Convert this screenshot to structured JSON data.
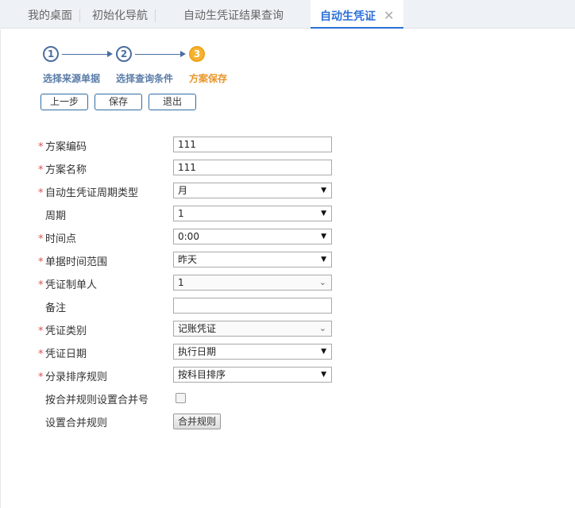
{
  "tabs": [
    {
      "label": "我的桌面"
    },
    {
      "label": "初始化导航"
    },
    {
      "label": "自动生凭证结果查询"
    },
    {
      "label": "自动生凭证",
      "close": "✕"
    }
  ],
  "steps": [
    {
      "num": "1",
      "label": "选择来源单据"
    },
    {
      "num": "2",
      "label": "选择查询条件"
    },
    {
      "num": "3",
      "label": "方案保存"
    }
  ],
  "buttons": {
    "prev": "上一步",
    "save": "保存",
    "exit": "退出"
  },
  "form": {
    "code": {
      "label": "方案编码",
      "value": "111"
    },
    "name": {
      "label": "方案名称",
      "value": "111"
    },
    "period_type": {
      "label": "自动生凭证周期类型",
      "value": "月"
    },
    "period": {
      "label": "周期",
      "value": "1"
    },
    "time": {
      "label": "时间点",
      "value": "0:00"
    },
    "range": {
      "label": "单据时间范围",
      "value": "昨天"
    },
    "maker": {
      "label": "凭证制单人",
      "value": "1"
    },
    "remark": {
      "label": "备注",
      "value": ""
    },
    "voucher_type": {
      "label": "凭证类别",
      "value": "记账凭证"
    },
    "voucher_date": {
      "label": "凭证日期",
      "value": "执行日期"
    },
    "sort_rule": {
      "label": "分录排序规则",
      "value": "按科目排序"
    },
    "merge_no": {
      "label": "按合并规则设置合并号"
    },
    "merge_rule": {
      "label": "设置合并规则",
      "button": "合并规则"
    }
  },
  "colors": {
    "accent": "#2c6fd6",
    "step": "#4a6ea0",
    "step_current": "#f5b330",
    "required": "#d9534f"
  }
}
